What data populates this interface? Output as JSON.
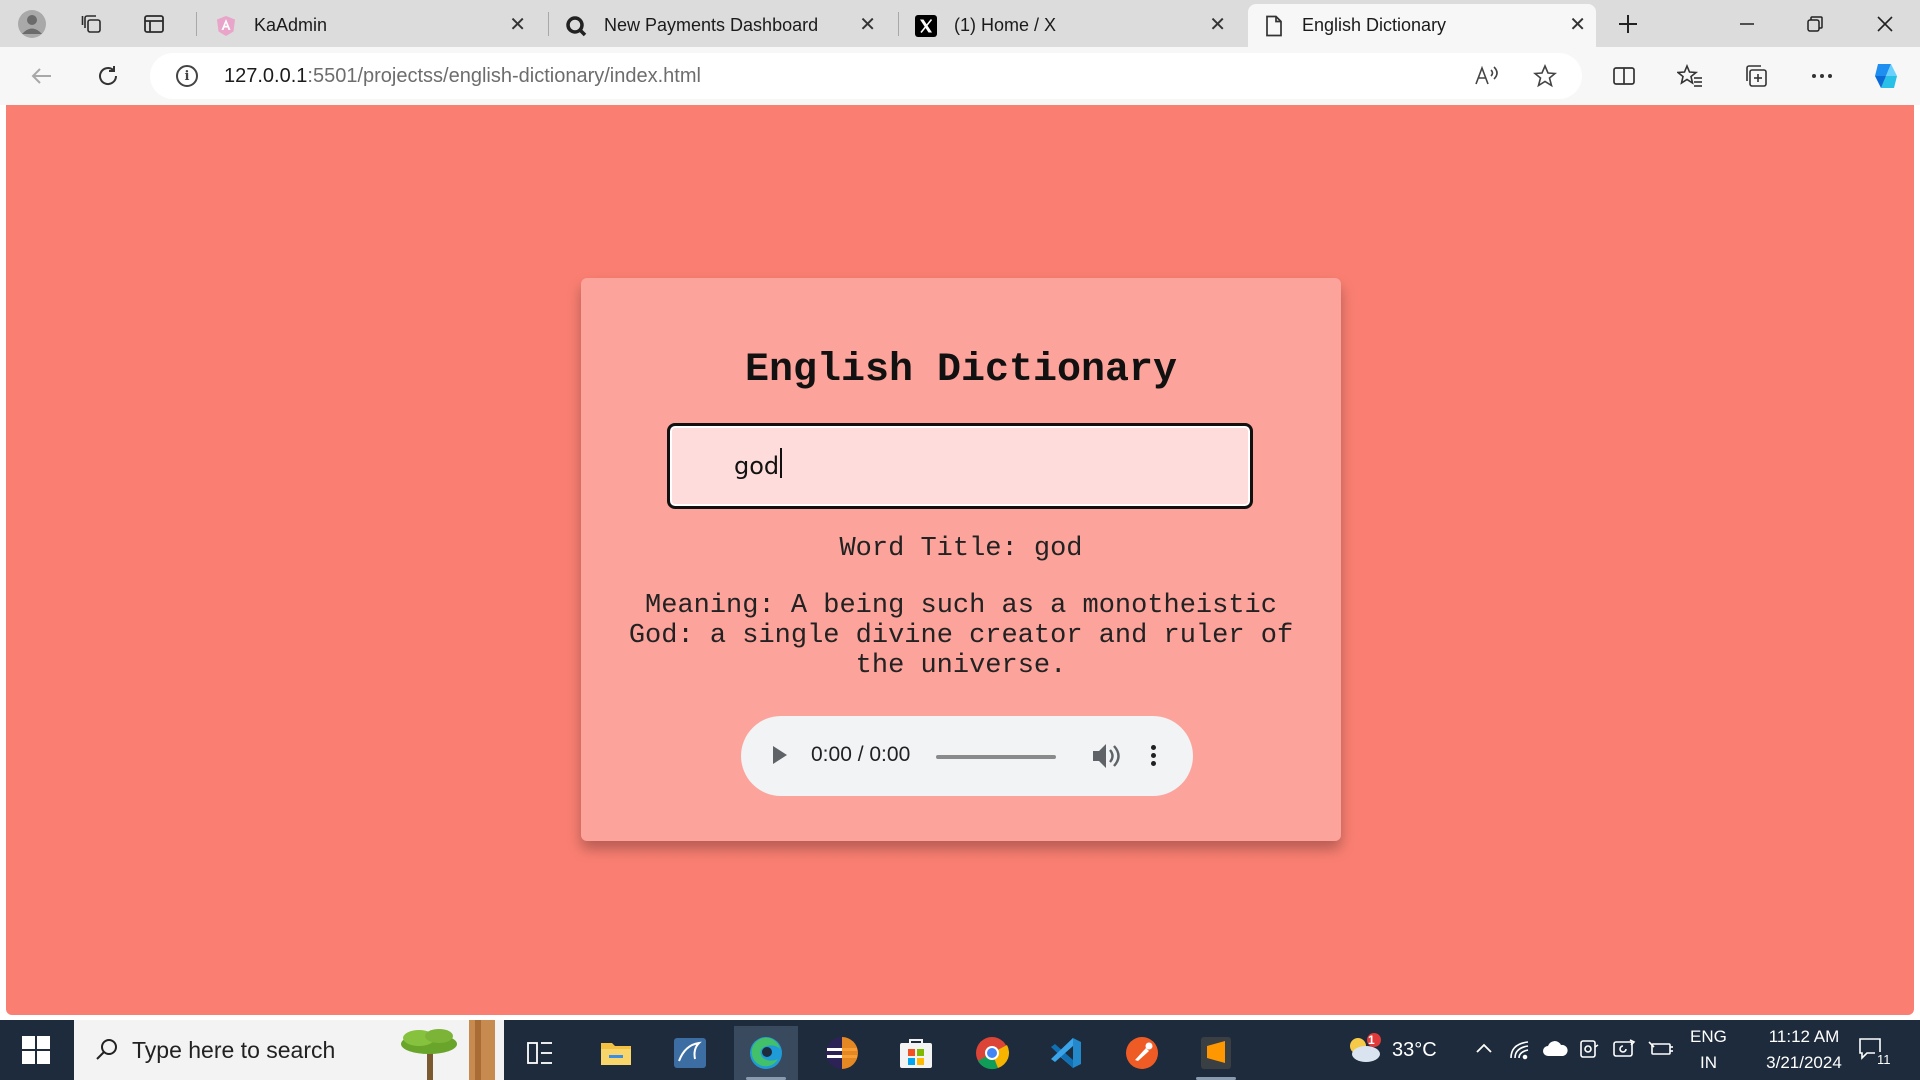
{
  "browser": {
    "tabs": [
      {
        "title": "KaAdmin",
        "icon": "angular-icon"
      },
      {
        "title": "New Payments Dashboard",
        "icon": "search-q-icon"
      },
      {
        "title": "(1) Home / X",
        "icon": "x-logo-icon"
      },
      {
        "title": "English Dictionary",
        "icon": "page-icon",
        "active": true
      }
    ],
    "url_host": "127.0.0.1",
    "url_path": ":5501/projectss/english-dictionary/index.html"
  },
  "page": {
    "title": "English Dictionary",
    "search_value": "god",
    "word_title": "Word Title: god",
    "meaning": "Meaning: A being such as a monotheistic God: a single divine creator and ruler of the universe.",
    "audio_time": "0:00 / 0:00"
  },
  "taskbar": {
    "search_placeholder": "Type here to search",
    "weather_temp": "33°C",
    "weather_badge": "1",
    "lang_primary": "ENG",
    "lang_secondary": "IN",
    "time": "11:12 AM",
    "date": "3/21/2024",
    "notification_count": "11"
  }
}
